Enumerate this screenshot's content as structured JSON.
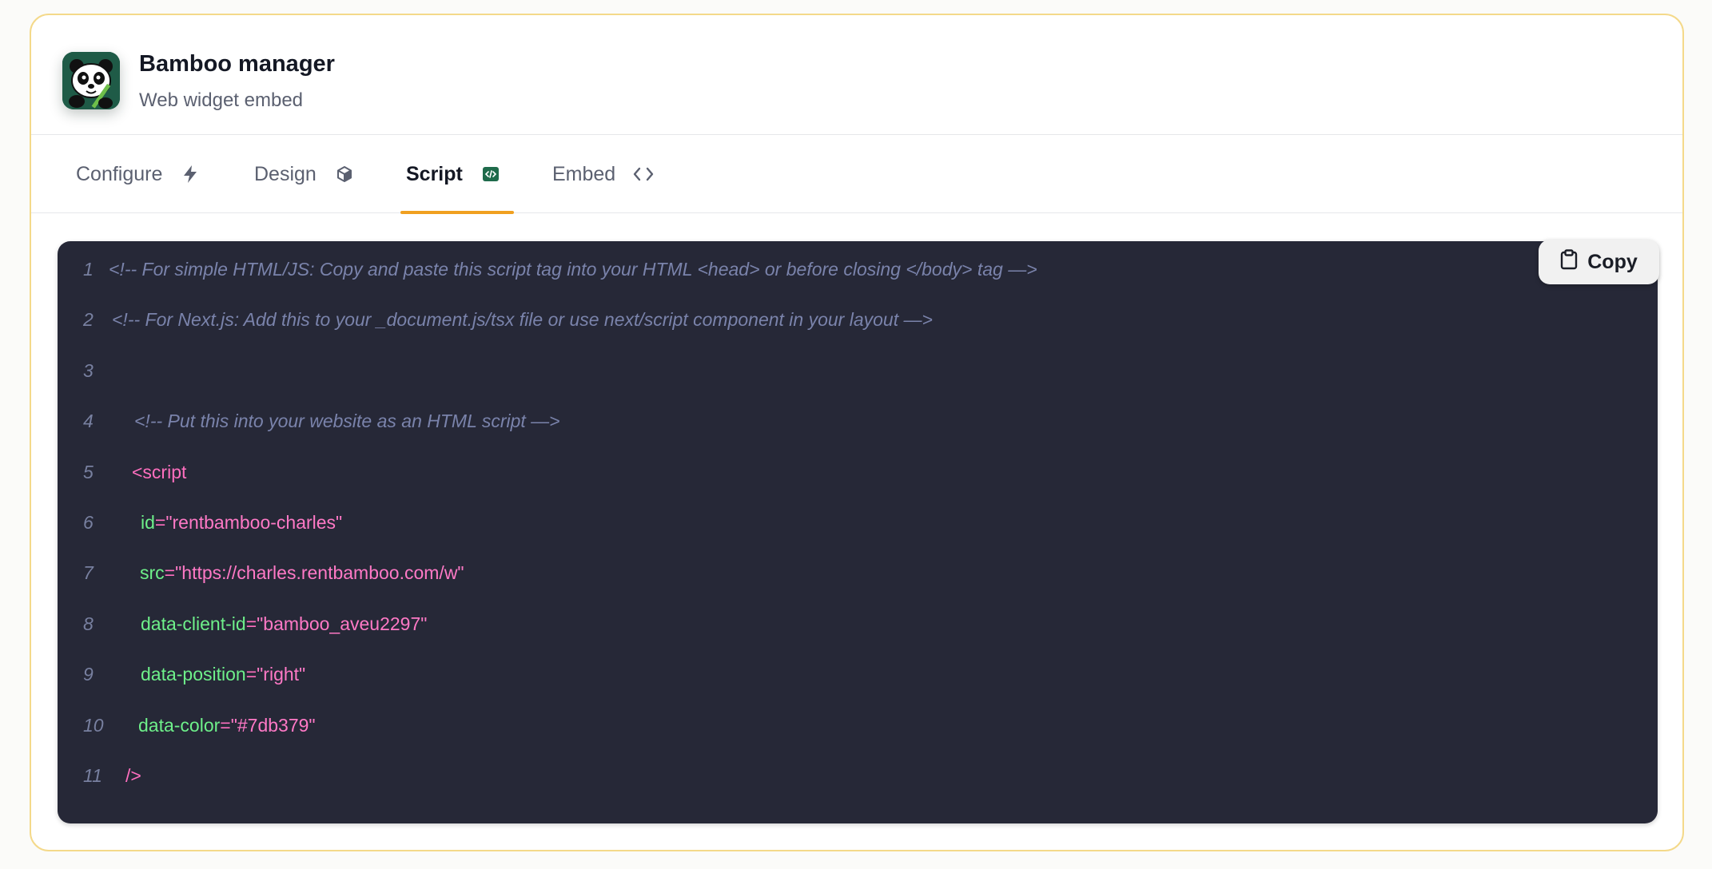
{
  "header": {
    "title": "Bamboo manager",
    "subtitle": "Web widget embed"
  },
  "tabs": [
    {
      "label": "Configure",
      "icon": "lightning-icon",
      "active": false
    },
    {
      "label": "Design",
      "icon": "cube-icon",
      "active": false
    },
    {
      "label": "Script",
      "icon": "code-file-icon",
      "active": true
    },
    {
      "label": "Embed",
      "icon": "code-brackets-icon",
      "active": false
    }
  ],
  "copy_button": {
    "label": "Copy",
    "icon": "clipboard-icon"
  },
  "code": {
    "line_numbers": [
      "1",
      "2",
      "3",
      "4",
      "5",
      "6",
      "7",
      "8",
      "9",
      "10",
      "11"
    ],
    "line1": "<!-- For simple HTML/JS: Copy and paste this script tag into your HTML <head> or before closing </body> tag —>",
    "line2": "<!-- For Next.js: Add this to your _document.js/tsx file or use next/script component in your layout —>",
    "line4": "<!-- Put this into your website as an HTML script —>",
    "line5": "<script",
    "line6": {
      "attr": "id",
      "value": "\"rentbamboo-charles\""
    },
    "line7": {
      "attr": "src",
      "value": "\"https://charles.rentbamboo.com/w\""
    },
    "line8": {
      "attr": "data-client-id",
      "value": "\"bamboo_aveu2297\""
    },
    "line9": {
      "attr": "data-position",
      "value": "\"right\""
    },
    "line10": {
      "attr": "data-color",
      "value": "\"#7db379\""
    },
    "line11": "/>",
    "equals": "="
  },
  "colors": {
    "accent": "#f0a020",
    "card_border": "#f4d98a",
    "code_bg": "#262837",
    "comment": "#7a83ab",
    "tag": "#ff6fbf",
    "attribute": "#6ef08a"
  }
}
